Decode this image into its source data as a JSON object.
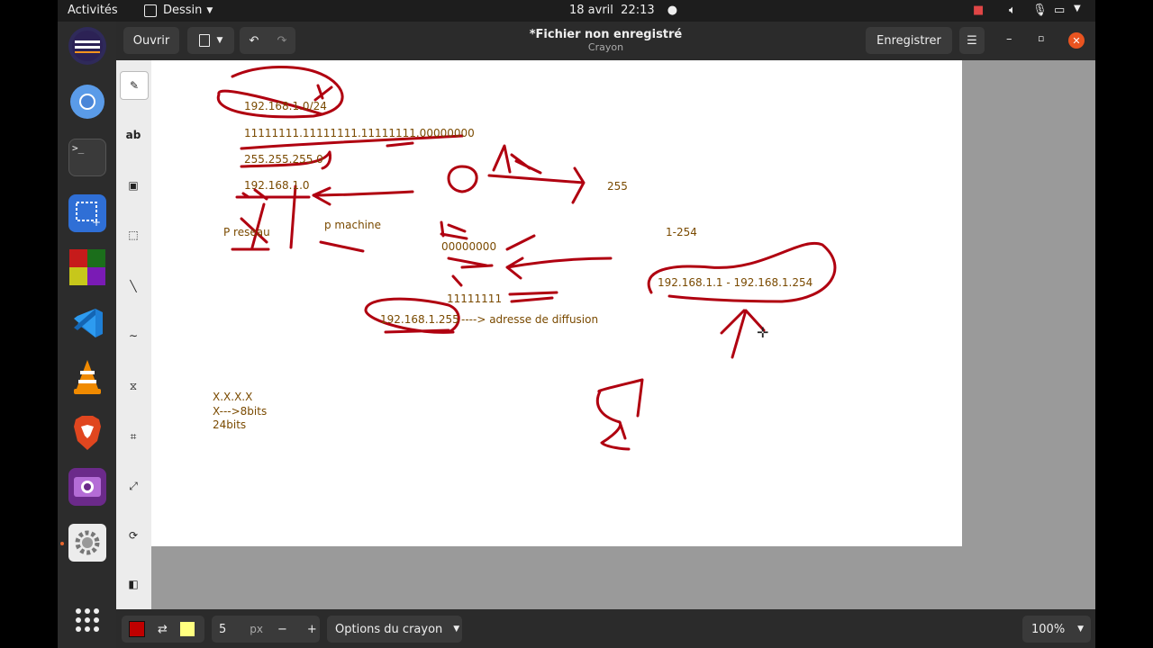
{
  "topbar": {
    "activities": "Activités",
    "app_menu": "Dessin",
    "date": "18 avril",
    "time": "22:13"
  },
  "dock": {
    "apps": [
      "eclipse-icon",
      "chromium-icon",
      "terminal-icon",
      "screenshot-icon",
      "game-icon",
      "vscode-icon",
      "vlc-icon",
      "brave-icon",
      "screen-recorder-icon",
      "settings-icon"
    ],
    "grid": "show-applications-icon"
  },
  "window": {
    "open_label": "Ouvrir",
    "title": "*Fichier non enregistré",
    "subtitle": "Crayon",
    "save_label": "Enregistrer"
  },
  "tools": [
    {
      "name": "pencil-tool",
      "glyph": "✎"
    },
    {
      "name": "text-tool",
      "glyph": "ab"
    },
    {
      "name": "rect-select-tool",
      "glyph": "▣"
    },
    {
      "name": "free-select-tool",
      "glyph": "⬚"
    },
    {
      "name": "line-tool",
      "glyph": "╲"
    },
    {
      "name": "curve-tool",
      "glyph": "∼"
    },
    {
      "name": "shape-tool",
      "glyph": "⧖"
    },
    {
      "name": "crop-tool",
      "glyph": "⌗"
    },
    {
      "name": "scale-tool",
      "glyph": "⤢"
    },
    {
      "name": "rotate-tool",
      "glyph": "⟳"
    },
    {
      "name": "filters-tool",
      "glyph": "◧"
    }
  ],
  "canvas_texts": [
    "192.168.1.0/24",
    "11111111.11111111.11111111.00000000",
    "255.255.255.0",
    "192.168.1.0",
    "P reseau",
    "p machine",
    "00000000",
    "255",
    "1-254",
    "192.168.1.1 -  192.168.1.254",
    "11111111",
    "192.168.1.255",
    "----> adresse de diffusion",
    "X.X.X.X",
    "X--->8bits",
    "24bits"
  ],
  "bottom": {
    "main_color": "#c00000",
    "secondary_color": "#ffff80",
    "size_value": "5",
    "size_unit": "px",
    "minus": "−",
    "plus": "+",
    "options_label": "Options du crayon",
    "zoom": "100%"
  },
  "colors": {
    "ink": "#b00010",
    "text": "#7a4a00"
  }
}
